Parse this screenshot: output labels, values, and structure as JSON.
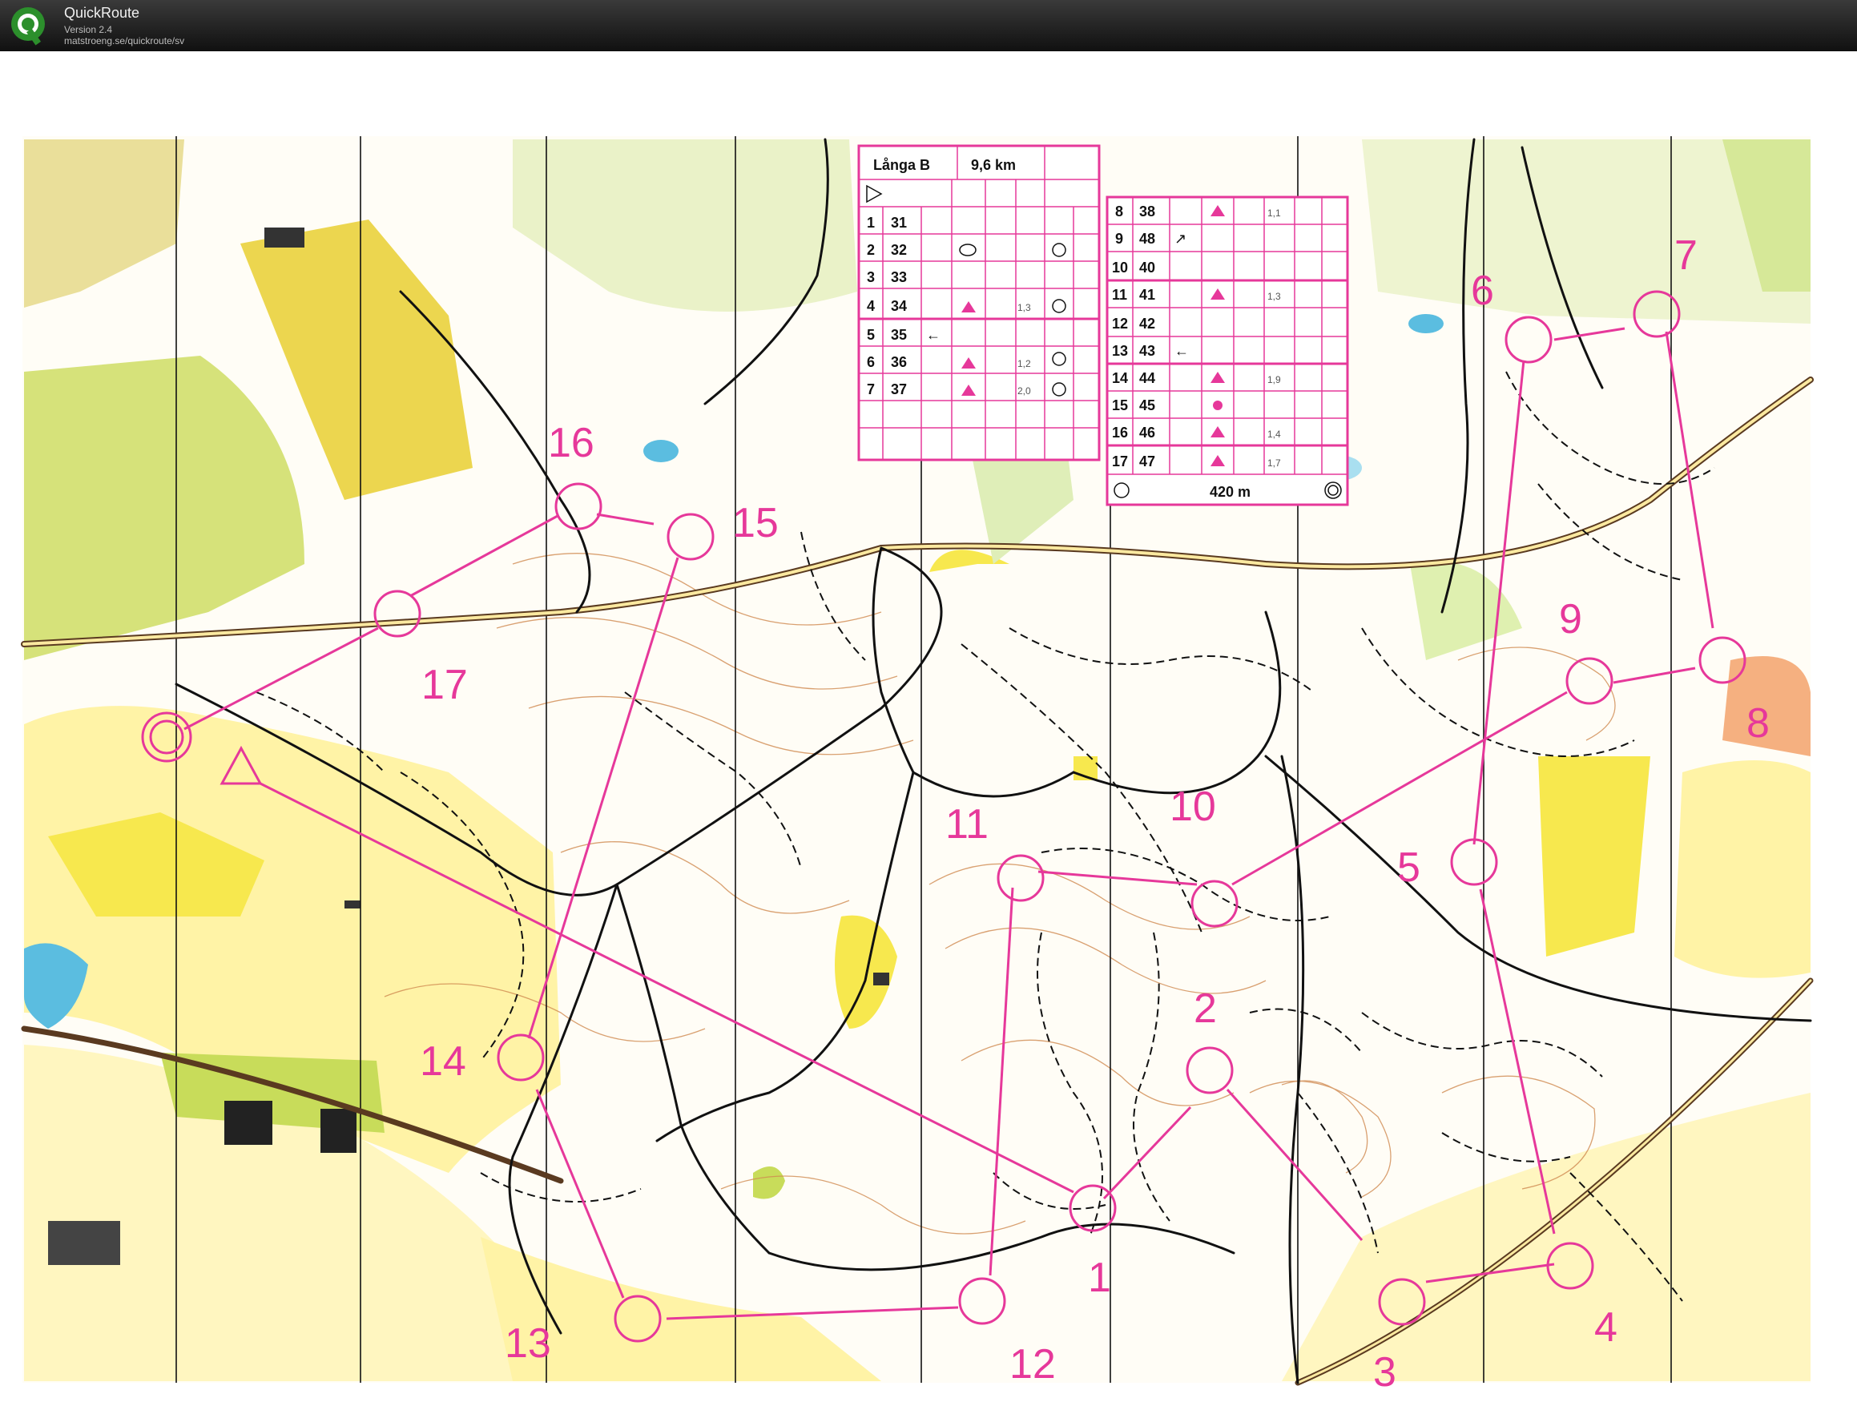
{
  "app": {
    "title": "QuickRoute",
    "version": "Version 2.4",
    "url": "matstroeng.se/quickroute/sv"
  },
  "colors": {
    "course": "#e6389a",
    "open_land": "#f7e84e",
    "rough_open": "#fff7b0",
    "green": "#c8dc5a",
    "water": "#5bbde0",
    "contour": "#c8773a",
    "path": "#111111"
  },
  "course": {
    "start_icon": "start-triangle-icon",
    "controls": [
      {
        "label": "1"
      },
      {
        "label": "2"
      },
      {
        "label": "3"
      },
      {
        "label": "4"
      },
      {
        "label": "5"
      },
      {
        "label": "6"
      },
      {
        "label": "7"
      },
      {
        "label": "8"
      },
      {
        "label": "9"
      },
      {
        "label": "10"
      },
      {
        "label": "11"
      },
      {
        "label": "12"
      },
      {
        "label": "13"
      },
      {
        "label": "14"
      },
      {
        "label": "15"
      },
      {
        "label": "16"
      },
      {
        "label": "17"
      }
    ]
  },
  "description_sheet_1": {
    "course_name": "Långa B",
    "length": "9,6 km",
    "rows": [
      {
        "n": "1",
        "code": "31",
        "dir": "",
        "dist": ""
      },
      {
        "n": "2",
        "code": "32",
        "dir": "",
        "dist": ""
      },
      {
        "n": "3",
        "code": "33",
        "dir": "",
        "dist": ""
      },
      {
        "n": "4",
        "code": "34",
        "dir": "",
        "dist": "1,3"
      },
      {
        "n": "5",
        "code": "35",
        "dir": "←",
        "dist": ""
      },
      {
        "n": "6",
        "code": "36",
        "dir": "",
        "dist": "1,2"
      },
      {
        "n": "7",
        "code": "37",
        "dir": "",
        "dist": "2,0"
      }
    ]
  },
  "description_sheet_2": {
    "rows": [
      {
        "n": "8",
        "code": "38",
        "dir": "",
        "dist": "1,1"
      },
      {
        "n": "9",
        "code": "48",
        "dir": "↗",
        "dist": ""
      },
      {
        "n": "10",
        "code": "40",
        "dir": "",
        "dist": ""
      },
      {
        "n": "11",
        "code": "41",
        "dir": "",
        "dist": "1,3"
      },
      {
        "n": "12",
        "code": "42",
        "dir": "",
        "dist": ""
      },
      {
        "n": "13",
        "code": "43",
        "dir": "←",
        "dist": ""
      },
      {
        "n": "14",
        "code": "44",
        "dir": "",
        "dist": "1,9"
      },
      {
        "n": "15",
        "code": "45",
        "dir": "",
        "dist": ""
      },
      {
        "n": "16",
        "code": "46",
        "dir": "",
        "dist": "1,4"
      },
      {
        "n": "17",
        "code": "47",
        "dir": "",
        "dist": "1,7"
      }
    ],
    "finish_distance": "420 m"
  }
}
